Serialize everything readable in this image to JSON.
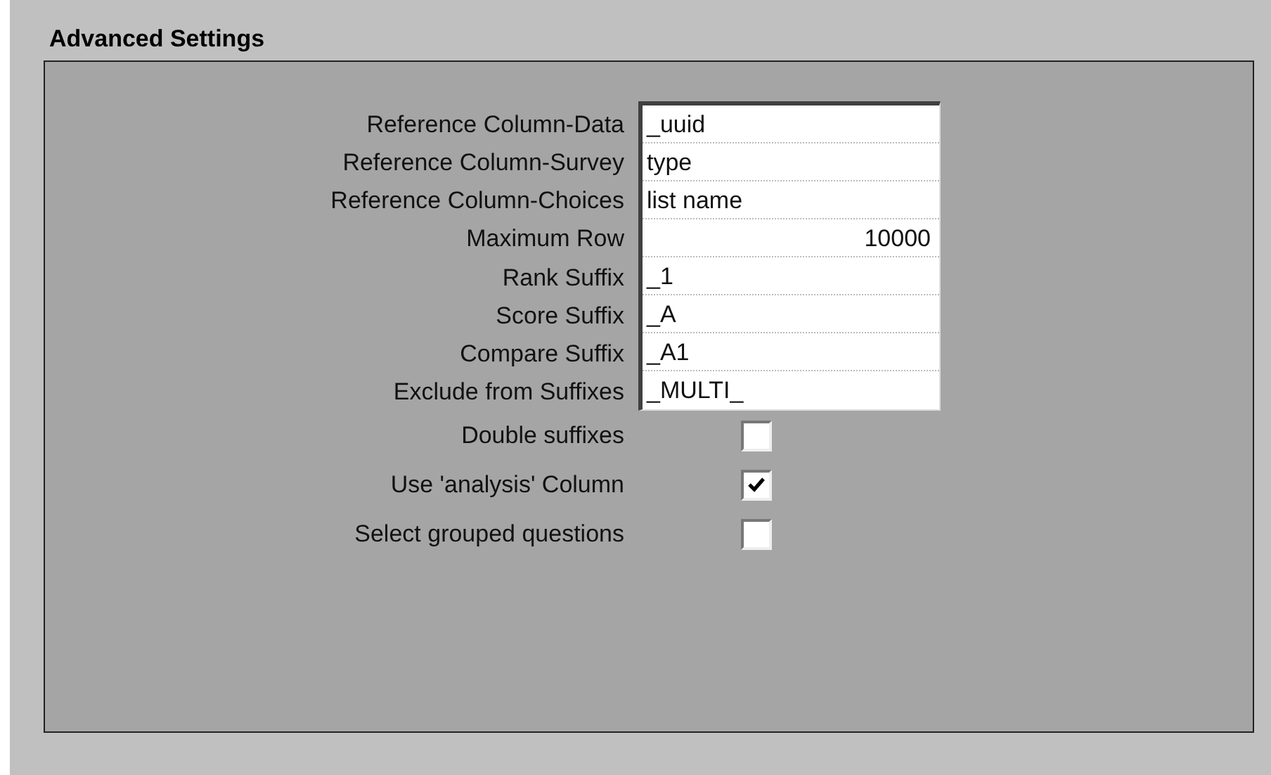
{
  "title": "Advanced Settings",
  "settings": [
    {
      "kind": "text",
      "label": "Reference Column-Data",
      "value": "_uuid"
    },
    {
      "kind": "text",
      "label": "Reference Column-Survey",
      "value": "type"
    },
    {
      "kind": "text",
      "label": "Reference Column-Choices",
      "value": "list name"
    },
    {
      "kind": "number",
      "label": "Maximum Row",
      "value": "10000"
    },
    {
      "kind": "text",
      "label": "Rank Suffix",
      "value": "_1"
    },
    {
      "kind": "text",
      "label": "Score Suffix",
      "value": "_A"
    },
    {
      "kind": "text",
      "label": "Compare Suffix",
      "value": "_A1"
    },
    {
      "kind": "text",
      "label": "Exclude from Suffixes",
      "value": "_MULTI_"
    },
    {
      "kind": "checkbox",
      "label": "Double suffixes",
      "checked": false
    },
    {
      "kind": "checkbox",
      "label": "Use 'analysis' Column",
      "checked": true
    },
    {
      "kind": "checkbox",
      "label": "Select grouped questions",
      "checked": false
    }
  ]
}
